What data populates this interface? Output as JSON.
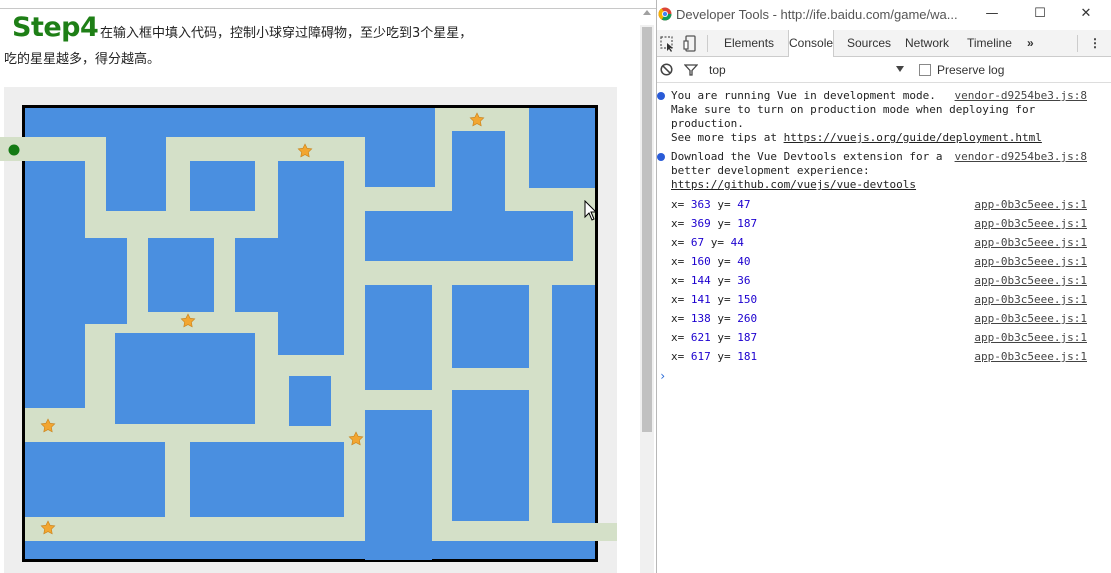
{
  "page": {
    "title": "Step4",
    "instruction_line1": "在输入框中填入代码，控制小球穿过障碍物，至少吃到3个星星，",
    "instruction_line2": "吃的星星越多，得分越高。"
  },
  "colors": {
    "title_green": "#1e7f16",
    "wall_blue": "#4a8fe0",
    "path_green": "#d4e0c8",
    "ball_green": "#147a14",
    "star_orange": "#f2a631",
    "number_blue": "#1c00cf"
  },
  "game": {
    "ball": "green-ball",
    "stars_count": 6
  },
  "devtools": {
    "window_title": "Developer Tools - http://ife.baidu.com/game/wa...",
    "tabs": [
      "Elements",
      "Console",
      "Sources",
      "Network",
      "Timeline",
      "»"
    ],
    "active_tab": "Console",
    "context": "top",
    "preserve_log_label": "Preserve log",
    "messages": [
      {
        "lines": [
          "You are running Vue in development mode.",
          "Make sure to turn on production mode when deploying for",
          "production."
        ],
        "tip_prefix": "See more tips at ",
        "tip_link": "https://vuejs.org/guide/deployment.html",
        "source": "vendor-d9254be3.js:8"
      },
      {
        "lines": [
          "Download the Vue Devtools extension for a",
          "better development experience:"
        ],
        "tip_link": "https://github.com/vuejs/vue-devtools",
        "source": "vendor-d9254be3.js:8"
      }
    ],
    "logs": [
      {
        "x": "363",
        "y": "47",
        "source": "app-0b3c5eee.js:1"
      },
      {
        "x": "369",
        "y": "187",
        "source": "app-0b3c5eee.js:1"
      },
      {
        "x": "67",
        "y": "44",
        "source": "app-0b3c5eee.js:1"
      },
      {
        "x": "160",
        "y": "40",
        "source": "app-0b3c5eee.js:1"
      },
      {
        "x": "144",
        "y": "36",
        "source": "app-0b3c5eee.js:1"
      },
      {
        "x": "141",
        "y": "150",
        "source": "app-0b3c5eee.js:1"
      },
      {
        "x": "138",
        "y": "260",
        "source": "app-0b3c5eee.js:1"
      },
      {
        "x": "621",
        "y": "187",
        "source": "app-0b3c5eee.js:1"
      },
      {
        "x": "617",
        "y": "181",
        "source": "app-0b3c5eee.js:1"
      }
    ],
    "log_x_label": "x=",
    "log_y_label": "y="
  }
}
